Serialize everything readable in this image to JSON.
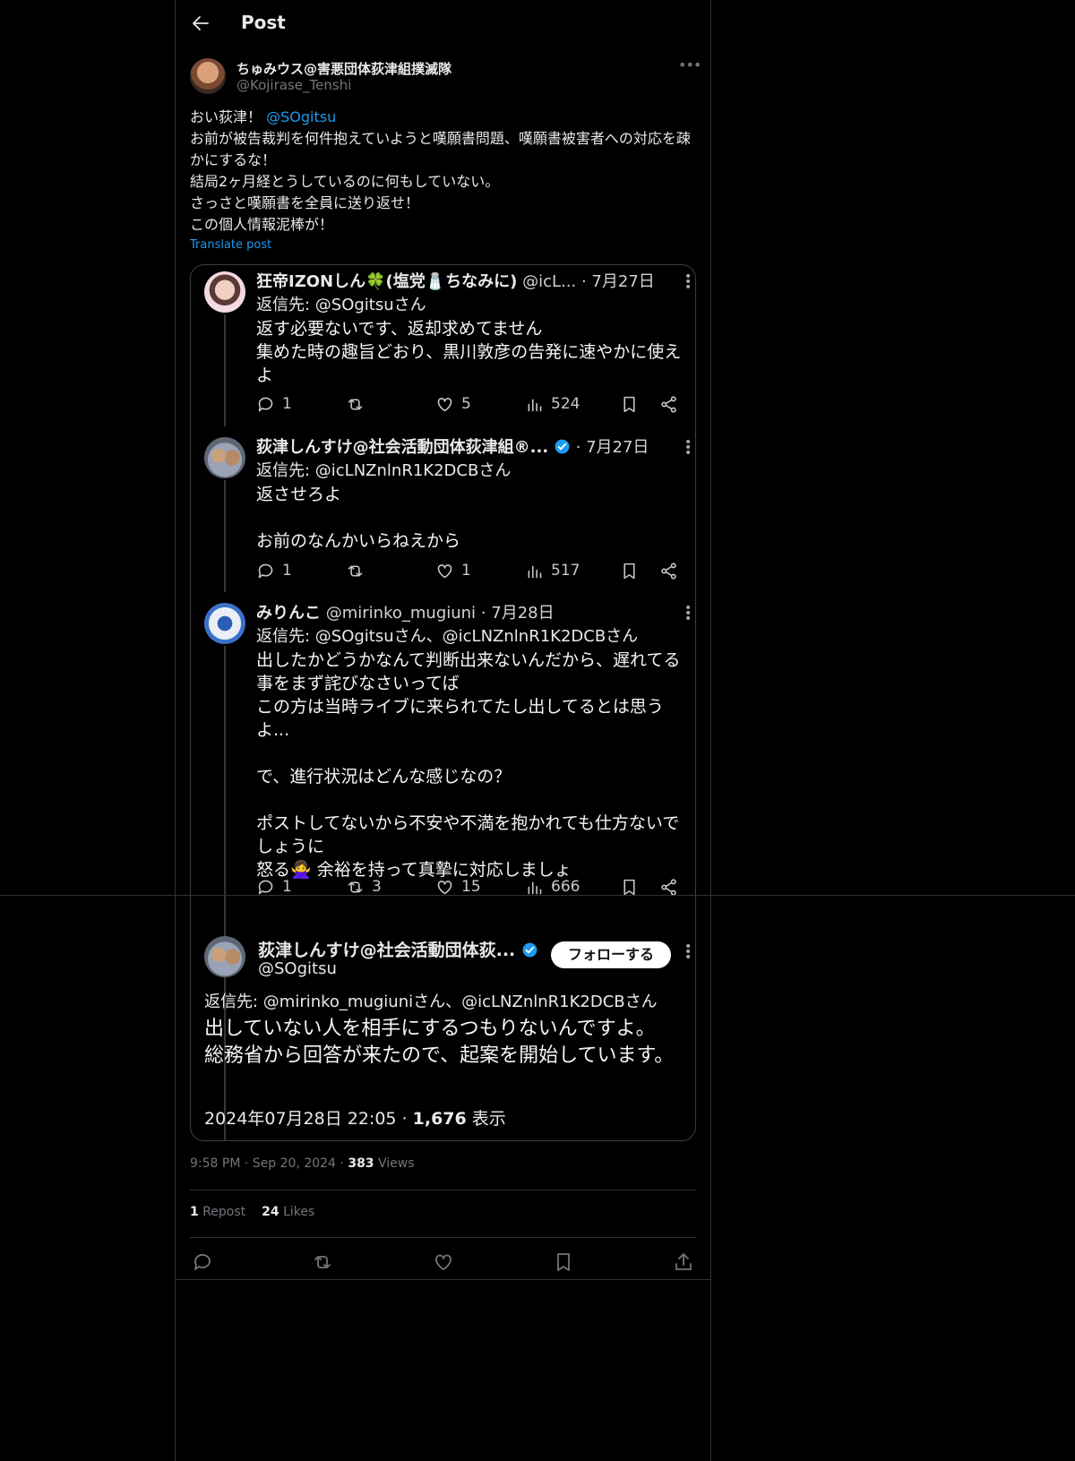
{
  "header": {
    "title": "Post"
  },
  "author": {
    "name": "ちゅみウス@害悪団体荻津組撲滅隊",
    "handle": "@Kojirase_Tenshi"
  },
  "post": {
    "greeting": "おい荻津！",
    "mention": "@SOgitsu",
    "lines": [
      "お前が被告裁判を何件抱えていようと嘆願書問題、嘆願書被害者への対応を疎かにするな！",
      "結局2ヶ月経とうしているのに何もしていない。",
      "さっさと嘆願書を全員に送り返せ！",
      "この個人情報泥棒が！"
    ],
    "translate_label": "Translate post"
  },
  "thread": {
    "replies": [
      {
        "name": "狂帝IZONしん🍀(塩党🧂ちなみに)",
        "handle": "@icL...",
        "date": "· 7月27日",
        "reply_to": "返信先: @SOgitsuさん",
        "lines": [
          "返す必要ないです、返却求めてません",
          "集めた時の趣旨どおり、黒川敦彦の告発に速やかに使えよ"
        ],
        "replies": "1",
        "reposts": "",
        "likes": "5",
        "views": "524"
      },
      {
        "name": "荻津しんすけ@社会活動団体荻津組®...",
        "handle": "",
        "date": "· 7月27日",
        "reply_to": "返信先: @icLNZnlnR1K2DCBさん",
        "lines": [
          "返させろよ",
          "",
          "お前のなんかいらねえから"
        ],
        "replies": "1",
        "reposts": "",
        "likes": "1",
        "views": "517"
      },
      {
        "name": "みりんこ",
        "handle": "@mirinko_mugiuni",
        "date": "· 7月28日",
        "reply_to": "返信先: @SOgitsuさん、@icLNZnlnR1K2DCBさん",
        "lines": [
          "出したかどうかなんて判断出来ないんだから、遅れてる事をまず詫びなさいってば",
          "この方は当時ライブに来られてたし出してるとは思うよ...",
          "",
          "で、進行状況はどんな感じなの？",
          "",
          "ポストしてないから不安や不満を抱かれても仕方ないでしょうに",
          "怒る🙅‍♀️ 余裕を持って真摯に対応しましょ"
        ],
        "replies": "1",
        "reposts": "3",
        "likes": "15",
        "views": "666"
      }
    ],
    "final": {
      "name": "荻津しんすけ@社会活動団体荻...",
      "handle": "@SOgitsu",
      "follow_label": "フォローする",
      "reply_to": "返信先: @mirinko_mugiuniさん、@icLNZnlnR1K2DCBさん",
      "lines": [
        "出していない人を相手にするつもりないんですよ。",
        "総務省から回答が来たので、起案を開始しています。"
      ],
      "timestamp": "2024年07月28日 22:05 · ",
      "views_count": "1,676",
      "views_label": " 表示"
    }
  },
  "meta": {
    "time": "9:58 PM",
    "date": "Sep 20, 2024",
    "views_count": "383",
    "views_label": "Views"
  },
  "stats": {
    "reposts_count": "1",
    "reposts_label": "Repost",
    "likes_count": "24",
    "likes_label": "Likes"
  },
  "colors": {
    "background": "#000000",
    "text": "#e7e9ea",
    "muted": "#71767b",
    "link": "#1d9bf0",
    "verified": "#1d9bf0",
    "border": "#2f3336"
  },
  "icons": [
    "back-arrow-icon",
    "more-icon",
    "reply-icon",
    "repost-icon",
    "like-icon",
    "views-icon",
    "bookmark-icon",
    "share-icon",
    "verified-icon"
  ]
}
